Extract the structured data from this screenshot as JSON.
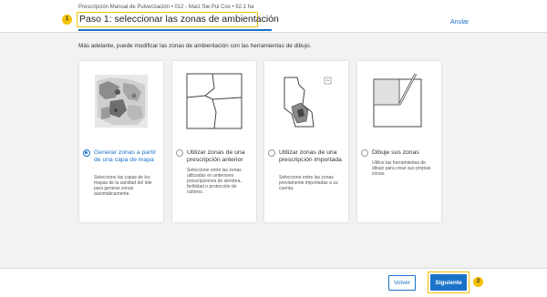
{
  "header": {
    "breadcrumb": "Prescripción Manual de Pulverización • 012 - Maíz Sie Pul Cos • 92.1 ha",
    "title": "Paso 1: seleccionar las zonas de ambientación",
    "step_badge": "1",
    "cancel_label": "Anular"
  },
  "intro": "Más adelante, puede modificar las zonas de ambientación con las herramientas de dibujo.",
  "options": [
    {
      "title": "Generar zonas a partir de una capa de mapa",
      "description": "Seleccione las capas de los mapas de la sanidad del lote para generar zonas automáticamente.",
      "selected": true,
      "icon": "heatmap-icon"
    },
    {
      "title": "Utilizar zonas de una prescripción anterior",
      "description": "Seleccione entre las zonas utilizadas en anteriores prescripciones de siembra, fertilidad o protección de cultivos.",
      "selected": false,
      "icon": "field-zones-icon"
    },
    {
      "title": "Utilizar zonas de una prescripción importada",
      "description": "Seleccione entre las zonas previamente importadas a su cuenta.",
      "selected": false,
      "icon": "imported-zones-icon"
    },
    {
      "title": "Dibuje sus zonas",
      "description": "Utilice las herramientas de dibujo para crear sus propias zonas.",
      "selected": false,
      "icon": "draw-zone-icon"
    }
  ],
  "footer": {
    "back_label": "Volver",
    "next_label": "Siguiente",
    "step_badge": "2"
  },
  "colors": {
    "accent": "#1a73c9",
    "highlight": "#f2c200"
  }
}
